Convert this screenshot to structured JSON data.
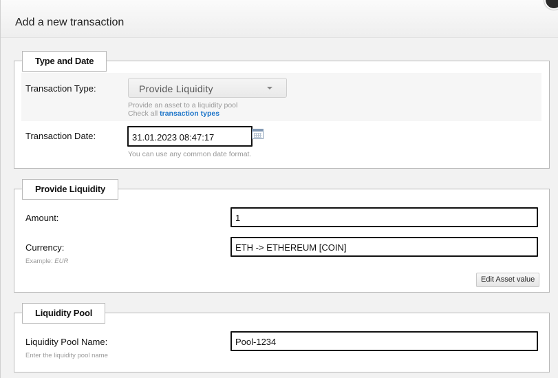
{
  "dialog": {
    "title": "Add a new transaction"
  },
  "type_and_date": {
    "legend": "Type and Date",
    "transaction_type_label": "Transaction Type:",
    "transaction_type_value": "Provide Liquidity",
    "type_hint_line1": "Provide an asset to a liquidity pool",
    "type_hint_prefix": "Check all ",
    "type_hint_link": "transaction types",
    "transaction_date_label": "Transaction Date:",
    "transaction_date_value": "31.01.2023 08:47:17",
    "date_hint": "You can use any common date format."
  },
  "provide_liquidity": {
    "legend": "Provide Liquidity",
    "amount_label": "Amount:",
    "amount_value": "1",
    "currency_label": "Currency:",
    "currency_value": "ETH -> ETHEREUM [COIN]",
    "currency_hint_prefix": "Example: ",
    "currency_hint_example": "EUR",
    "edit_asset_button": "Edit Asset value"
  },
  "liquidity_pool": {
    "legend": "Liquidity Pool",
    "pool_name_label": "Liquidity Pool Name:",
    "pool_name_value": "Pool-1234",
    "pool_name_hint": "Enter the liquidity pool name"
  },
  "icons": {
    "close": "close-icon",
    "calendar": "calendar-icon",
    "dropdown": "chevron-down-icon"
  }
}
